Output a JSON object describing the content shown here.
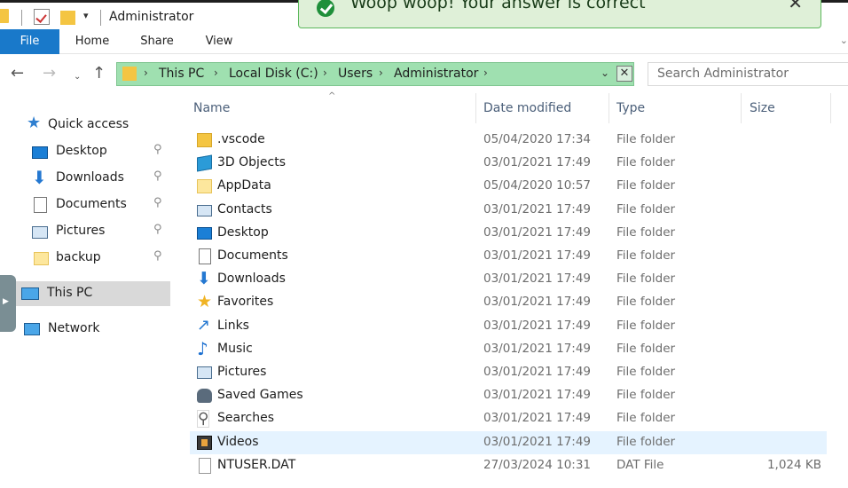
{
  "window": {
    "title": "Administrator",
    "qa_dropdown": "▾"
  },
  "toast": {
    "message": "Woop woop! Your answer is correct",
    "close": "✕"
  },
  "ribbon": {
    "tabs": [
      "File",
      "Home",
      "Share",
      "View"
    ],
    "expand": "⌄"
  },
  "nav": {
    "back": "←",
    "forward": "→",
    "recent": "⌄",
    "up": "↑"
  },
  "address": {
    "crumbs": [
      "This PC",
      "Local Disk (C:)",
      "Users",
      "Administrator"
    ],
    "separator": "›",
    "dropdown": "⌄",
    "clear": "✕"
  },
  "search": {
    "placeholder": "Search Administrator"
  },
  "navpane": {
    "quick_access": "Quick access",
    "items": [
      {
        "label": "Desktop",
        "icon": "desktop-icon",
        "pinned": true
      },
      {
        "label": "Downloads",
        "icon": "download-arrow-icon",
        "pinned": true
      },
      {
        "label": "Documents",
        "icon": "document-icon",
        "pinned": true
      },
      {
        "label": "Pictures",
        "icon": "pictures-icon",
        "pinned": true
      },
      {
        "label": "backup",
        "icon": "folder-icon",
        "pinned": true
      }
    ],
    "pin_glyph": "📌",
    "this_pc": "This PC",
    "network": "Network"
  },
  "columns": {
    "name": "Name",
    "date": "Date modified",
    "type": "Type",
    "size": "Size",
    "sort_caret": "^"
  },
  "files": [
    {
      "name": ".vscode",
      "date": "05/04/2020 17:34",
      "type": "File folder",
      "size": "",
      "icon": "folder-icon"
    },
    {
      "name": "3D Objects",
      "date": "03/01/2021 17:49",
      "type": "File folder",
      "size": "",
      "icon": "cube-icon"
    },
    {
      "name": "AppData",
      "date": "05/04/2020 10:57",
      "type": "File folder",
      "size": "",
      "icon": "folder-light-icon"
    },
    {
      "name": "Contacts",
      "date": "03/01/2021 17:49",
      "type": "File folder",
      "size": "",
      "icon": "contacts-icon"
    },
    {
      "name": "Desktop",
      "date": "03/01/2021 17:49",
      "type": "File folder",
      "size": "",
      "icon": "desktop-icon"
    },
    {
      "name": "Documents",
      "date": "03/01/2021 17:49",
      "type": "File folder",
      "size": "",
      "icon": "document-icon"
    },
    {
      "name": "Downloads",
      "date": "03/01/2021 17:49",
      "type": "File folder",
      "size": "",
      "icon": "download-arrow-icon"
    },
    {
      "name": "Favorites",
      "date": "03/01/2021 17:49",
      "type": "File folder",
      "size": "",
      "icon": "star-icon"
    },
    {
      "name": "Links",
      "date": "03/01/2021 17:49",
      "type": "File folder",
      "size": "",
      "icon": "link-arrow-icon"
    },
    {
      "name": "Music",
      "date": "03/01/2021 17:49",
      "type": "File folder",
      "size": "",
      "icon": "music-note-icon"
    },
    {
      "name": "Pictures",
      "date": "03/01/2021 17:49",
      "type": "File folder",
      "size": "",
      "icon": "pictures-icon"
    },
    {
      "name": "Saved Games",
      "date": "03/01/2021 17:49",
      "type": "File folder",
      "size": "",
      "icon": "game-controller-icon"
    },
    {
      "name": "Searches",
      "date": "03/01/2021 17:49",
      "type": "File folder",
      "size": "",
      "icon": "magnifier-icon"
    },
    {
      "name": "Videos",
      "date": "03/01/2021 17:49",
      "type": "File folder",
      "size": "",
      "icon": "video-film-icon",
      "selected": true
    },
    {
      "name": "NTUSER.DAT",
      "date": "27/03/2024 10:31",
      "type": "DAT File",
      "size": "1,024 KB",
      "icon": "file-icon"
    }
  ],
  "colors": {
    "accent": "#1979ca",
    "address_highlight": "#9fe0b0",
    "toast_bg": "#dff0d8",
    "selected_row": "#e5f3ff"
  }
}
